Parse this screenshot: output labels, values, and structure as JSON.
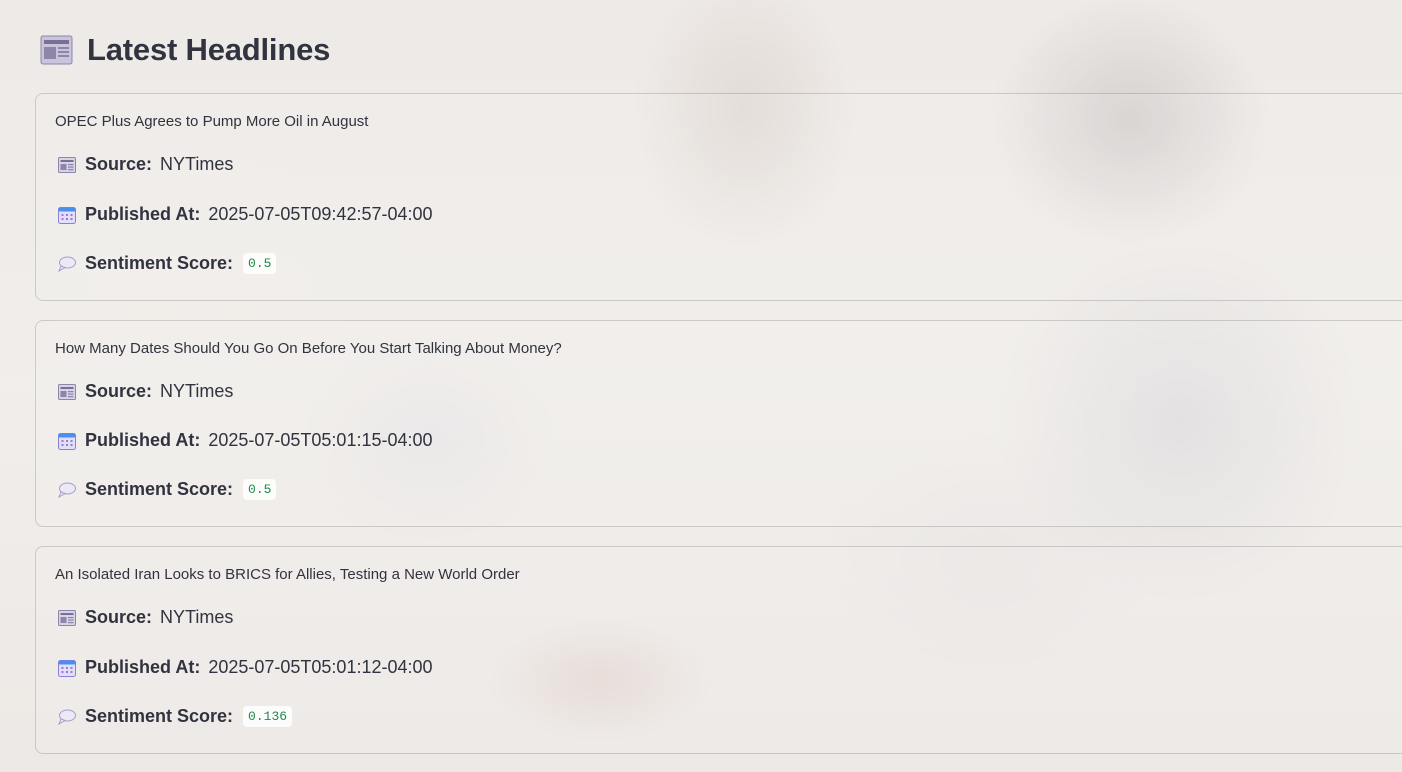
{
  "page": {
    "title": "Latest Headlines",
    "title_icon": "newspaper-icon"
  },
  "labels": {
    "source": "Source:",
    "published": "Published At:",
    "sentiment": "Sentiment Score:"
  },
  "icons": {
    "source": "newspaper-icon",
    "published": "calendar-icon",
    "sentiment": "speech-bubble-icon"
  },
  "colors": {
    "score_text": "#1f8a4c",
    "text": "#31333f"
  },
  "headlines": [
    {
      "title": "OPEC Plus Agrees to Pump More Oil in August",
      "source": "NYTimes",
      "published_at": "2025-07-05T09:42:57-04:00",
      "sentiment_score": "0.5"
    },
    {
      "title": "How Many Dates Should You Go On Before You Start Talking About Money?",
      "source": "NYTimes",
      "published_at": "2025-07-05T05:01:15-04:00",
      "sentiment_score": "0.5"
    },
    {
      "title": "An Isolated Iran Looks to BRICS for Allies, Testing a New World Order",
      "source": "NYTimes",
      "published_at": "2025-07-05T05:01:12-04:00",
      "sentiment_score": "0.136"
    }
  ]
}
